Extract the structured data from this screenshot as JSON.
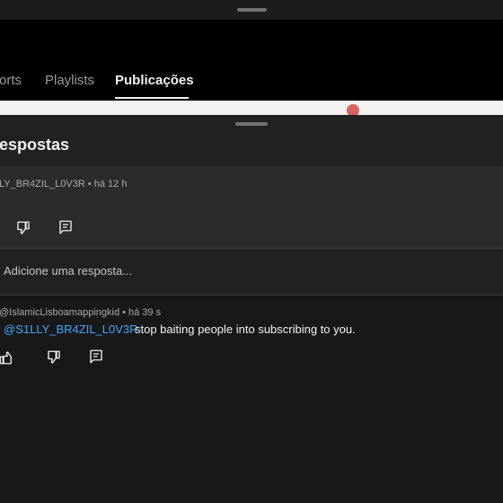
{
  "channel": {
    "tabs": [
      {
        "label": "orts",
        "active": false
      },
      {
        "label": "Playlists",
        "active": false
      },
      {
        "label": "Publicações",
        "active": true
      }
    ]
  },
  "sheet": {
    "title": "espostas",
    "parent_comment": {
      "author_meta": "LY_BR4ZIL_L0V3R • há 12 h"
    },
    "reply_placeholder": "Adicione uma resposta...",
    "reply": {
      "author_meta": "@IslamicLisboamappingkid • há 39 s",
      "mention": "@S1LLY_BR4ZIL_L0V3R",
      "text": "stop baiting people into subscribing to you."
    }
  },
  "icons": [
    "dislike-icon",
    "reply-icon",
    "like-icon"
  ],
  "colors": {
    "background": "#0f0f0f",
    "sheet": "#212121",
    "mention": "#3ea6ff",
    "accent_red": "#c8281e"
  }
}
